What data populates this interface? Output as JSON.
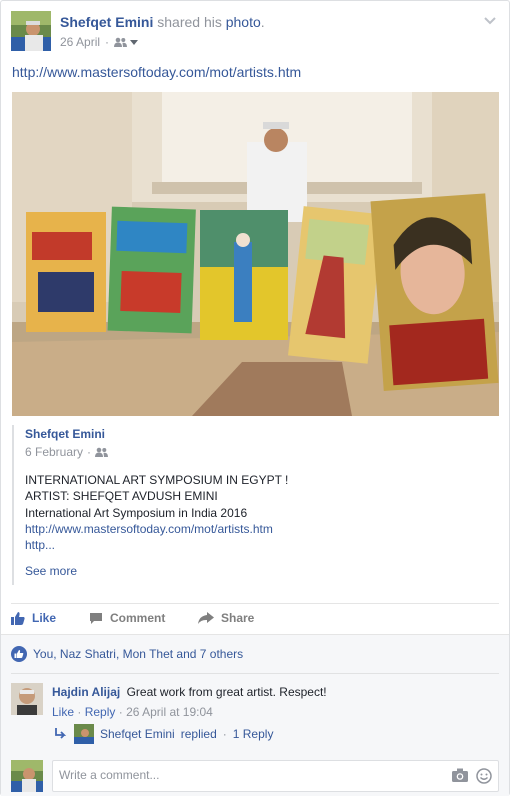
{
  "post": {
    "author": "Shefqet Emini",
    "action_text": "shared his",
    "object_link": "photo",
    "object_suffix": ".",
    "date": "26 April",
    "audience_icon": "friends-icon",
    "link": "http://www.mastersoftoday.com/mot/artists.htm"
  },
  "shared_post": {
    "author": "Shefqet Emini",
    "date": "6 February",
    "separator": "·",
    "lines": [
      "INTERNATIONAL ART SYMPOSIUM IN EGYPT !",
      "ARTIST: SHEFQET AVDUSH EMINI",
      "International Art Symposium in India 2016"
    ],
    "link": "http://www.mastersoftoday.com/mot/artists.htm",
    "truncated_link": "http...",
    "see_more": "See more"
  },
  "actions": {
    "like": "Like",
    "comment": "Comment",
    "share": "Share"
  },
  "likes_summary": "You, Naz Shatri, Mon Thet and 7 others",
  "comments": [
    {
      "author": "Hajdin Alijaj",
      "text": "Great work from great artist. Respect!",
      "like": "Like",
      "reply": "Reply",
      "sep": "·",
      "time": "26 April at 19:04",
      "reply_author": "Shefqet Emini",
      "reply_verb": "replied",
      "reply_count": "1 Reply"
    }
  ],
  "composer": {
    "placeholder": "Write a comment..."
  },
  "colors": {
    "link": "#365899",
    "accent": "#4267b2",
    "muted": "#90949c",
    "ufi_bg": "#f6f7f9"
  }
}
